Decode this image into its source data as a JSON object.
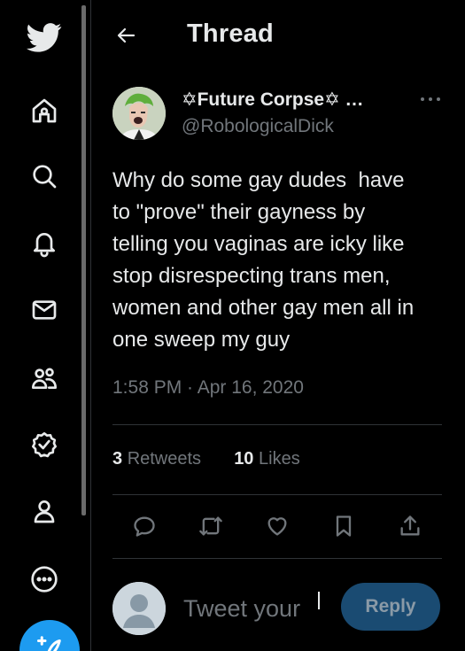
{
  "nav": {
    "items": [
      {
        "icon": "twitter-bird-icon"
      },
      {
        "icon": "home-icon"
      },
      {
        "icon": "search-icon"
      },
      {
        "icon": "bell-icon"
      },
      {
        "icon": "mail-icon"
      },
      {
        "icon": "people-icon"
      },
      {
        "icon": "verified-badge-icon"
      },
      {
        "icon": "profile-icon"
      },
      {
        "icon": "more-circle-icon"
      },
      {
        "icon": "compose-tweet-icon"
      }
    ],
    "accent": "#1d9bf0"
  },
  "header": {
    "title": "Thread",
    "back_icon": "arrow-left-icon"
  },
  "tweet": {
    "display_name": "✡Future Corpse✡ …",
    "handle": "@RobologicalDick",
    "text": "Why do some gay dudes  have\nto \"prove\" their gayness by\ntelling you vaginas are icky like\nstop disrespecting trans men,\nwomen and other gay men all in\none sweep my guy",
    "timestamp": "1:58 PM · Apr 16, 2020",
    "retweets": {
      "count": "3",
      "label": "Retweets"
    },
    "likes": {
      "count": "10",
      "label": "Likes"
    },
    "actions": [
      "reply-icon",
      "retweet-icon",
      "like-heart-icon",
      "bookmark-icon",
      "share-icon"
    ]
  },
  "reply_box": {
    "placeholder": "Tweet your",
    "button_label": "Reply"
  },
  "colors": {
    "background": "#000000",
    "text": "#e7e9ea",
    "muted": "#71767b",
    "border": "#2f3336",
    "reply_button": "#1a4b72"
  }
}
